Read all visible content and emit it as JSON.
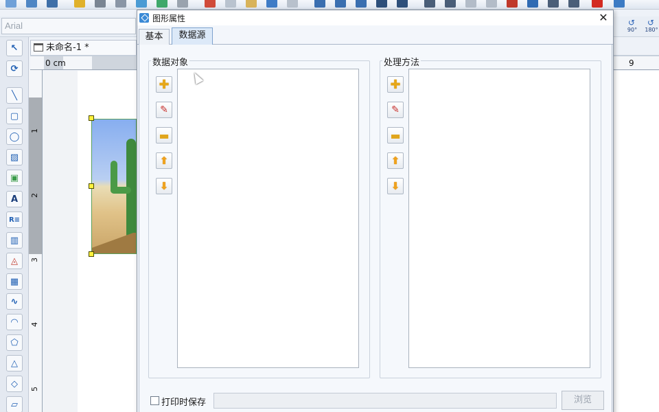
{
  "app": {
    "font_combo_value": "Arial",
    "document_tab_title": "未命名-1 *",
    "ruler": {
      "top_unit_label": "0 cm",
      "top_end_label": "9",
      "left_labels": [
        "1",
        "2",
        "3",
        "4",
        "5"
      ]
    },
    "rotate_buttons": [
      "90°",
      "180°"
    ],
    "tool_icons": [
      "pointer-icon",
      "rotate-icon",
      "line-icon",
      "rounded-rect-icon",
      "ellipse-icon",
      "image-icon",
      "picture-icon",
      "text-icon",
      "richtext-icon",
      "barcode-icon",
      "shape-icon",
      "qrcode-icon",
      "curve-icon",
      "arc-icon",
      "polygon-icon",
      "triangle-icon",
      "diamond-icon",
      "parallelogram-icon"
    ]
  },
  "dialog": {
    "title": "图形属性",
    "close_glyph": "✕",
    "tabs": [
      {
        "label": "基本",
        "active": false
      },
      {
        "label": "数据源",
        "active": true
      }
    ],
    "data_objects": {
      "label": "数据对象",
      "items": []
    },
    "processing": {
      "label": "处理方法",
      "items": []
    },
    "side_buttons": [
      "add-icon",
      "edit-icon",
      "remove-icon",
      "move-up-icon",
      "move-down-icon"
    ],
    "print_save_label": "打印时保存",
    "print_save_checked": false,
    "path_value": "",
    "browse_label": "浏览"
  },
  "colors": {
    "accent": "#3b8ad6",
    "active_tab": "#dce9f8",
    "button_glyph": "#f0a21d"
  }
}
